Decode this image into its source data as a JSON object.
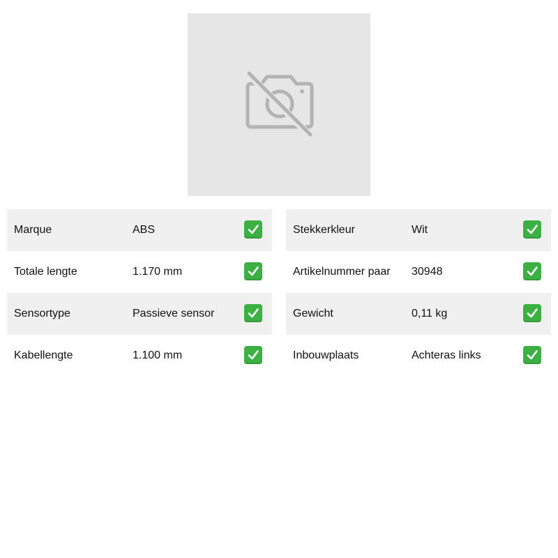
{
  "product_image": {
    "icon": "no-photo-icon"
  },
  "specs_left": [
    {
      "label": "Marque",
      "value": "ABS",
      "icon": "check-mark-icon"
    },
    {
      "label": "Totale lengte",
      "value": "1.170 mm",
      "icon": "check-mark-icon"
    },
    {
      "label": "Sensortype",
      "value": "Passieve sensor",
      "icon": "check-mark-icon"
    },
    {
      "label": "Kabellengte",
      "value": "1.100 mm",
      "icon": "check-mark-icon"
    }
  ],
  "specs_right": [
    {
      "label": "Stekkerkleur",
      "value": "Wit",
      "icon": "check-mark-icon"
    },
    {
      "label": "Artikelnummer paar",
      "value": "30948",
      "icon": "check-mark-icon"
    },
    {
      "label": "Gewicht",
      "value": "0,11 kg",
      "icon": "check-mark-icon"
    },
    {
      "label": "Inbouwplaats",
      "value": "Achteras links",
      "icon": "check-mark-icon"
    }
  ],
  "colors": {
    "row_shade": "#f0f0f0",
    "check_green": "#3cb043",
    "placeholder_bg": "#e6e6e6",
    "placeholder_icon": "#b3b3b3"
  }
}
